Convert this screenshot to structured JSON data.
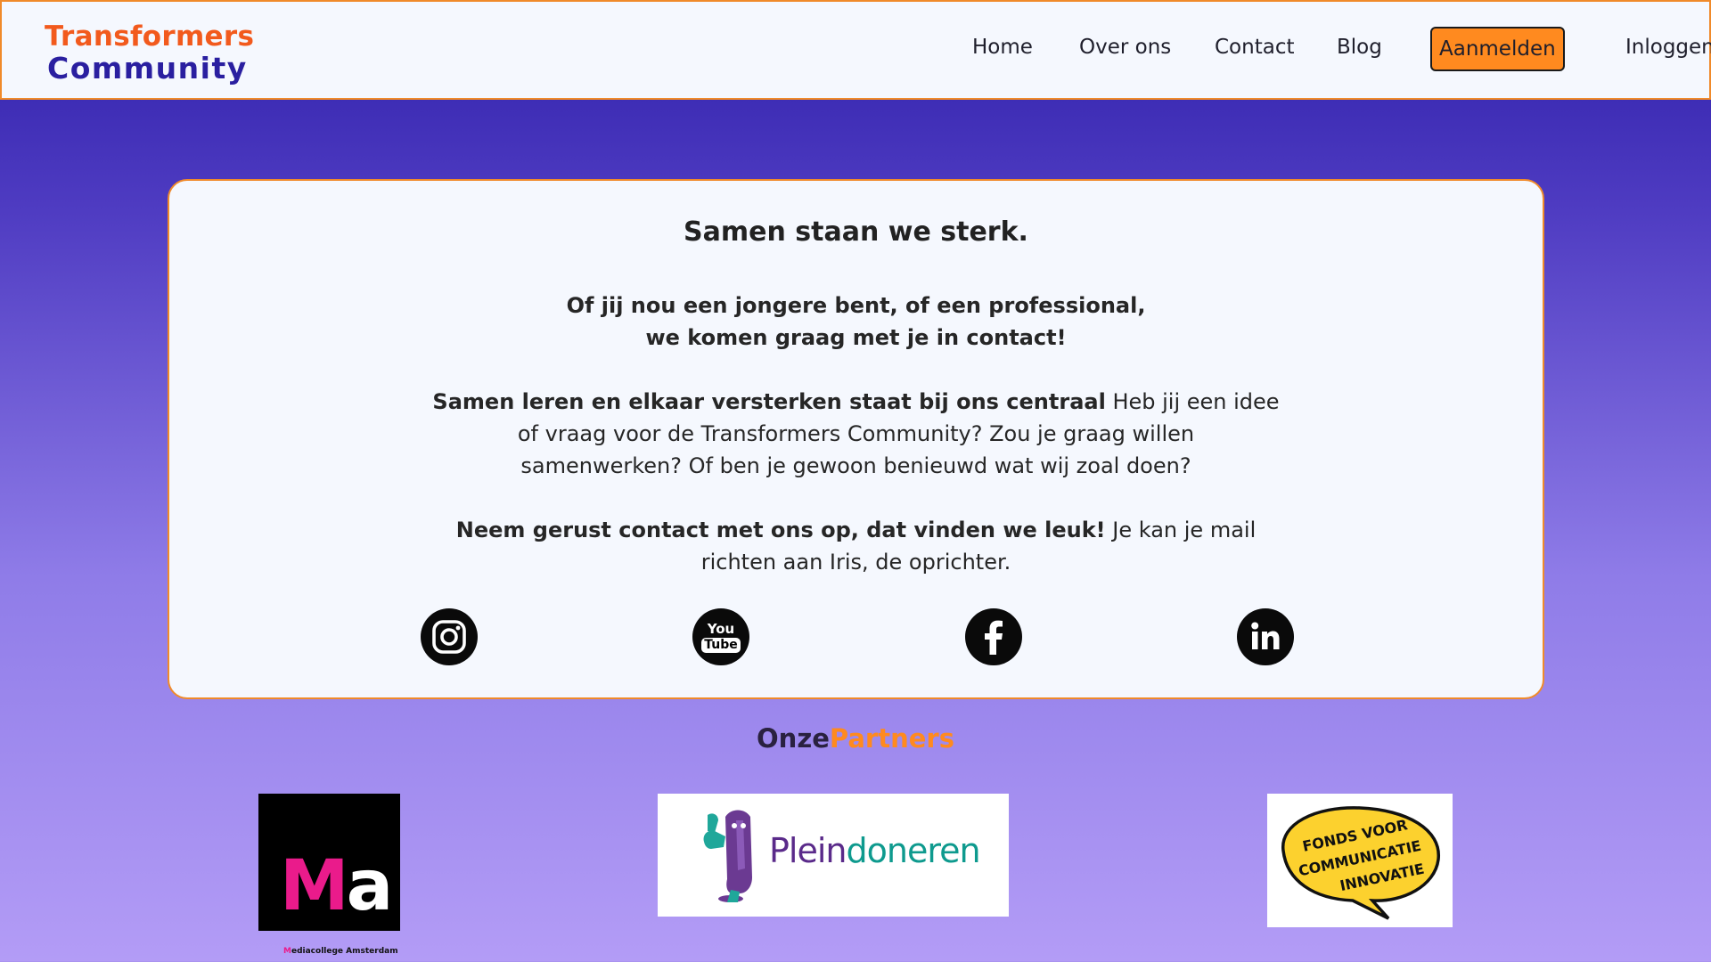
{
  "header": {
    "logo_line1": "Transformers",
    "logo_line2": "Community",
    "nav": {
      "home": "Home",
      "over_ons": "Over ons",
      "contact": "Contact",
      "blog": "Blog",
      "aanmelden": "Aanmelden",
      "inloggen": "Inloggen"
    }
  },
  "card": {
    "title": "Samen staan we sterk.",
    "intro_line1": "Of jij nou een jongere bent, of een professional,",
    "intro_line2": "we komen graag met je in contact!",
    "p1_bold": "Samen leren en elkaar versterken staat bij ons centraal",
    "p1_line1_rest": " Heb jij een idee",
    "p1_line2": "of vraag voor de Transformers Community? Zou je graag willen",
    "p1_line3": "samenwerken? Of ben je gewoon benieuwd wat wij zoal doen?",
    "p2_bold": "Neem gerust contact met ons op, dat vinden we leuk!",
    "p2_line1_rest": " Je kan je mail",
    "p2_line2": "richten aan Iris, de oprichter.",
    "social": [
      {
        "icon": "instagram-icon"
      },
      {
        "icon": "youtube-icon",
        "label_top": "You",
        "label_bottom": "Tube"
      },
      {
        "icon": "facebook-icon"
      },
      {
        "icon": "linkedin-icon"
      }
    ]
  },
  "partners": {
    "title_part1": "Onze",
    "title_part2": "Partners",
    "mediacollege": {
      "logo_m": "M",
      "logo_a": "a",
      "caption_m": "M",
      "caption_rest": "ediacollege Amsterdam"
    },
    "pleindoneren": {
      "name_part1": "Plein",
      "name_part2": "doneren"
    },
    "fonds": {
      "line1": "FONDS VOOR",
      "line2": "COMMUNICATIE",
      "line3": "INNOVATIE"
    }
  },
  "colors": {
    "accent_orange": "#ff8a1f",
    "logo_orange": "#f25a1d",
    "logo_purple": "#2a1fa0",
    "card_bg": "#f5f8fe"
  }
}
